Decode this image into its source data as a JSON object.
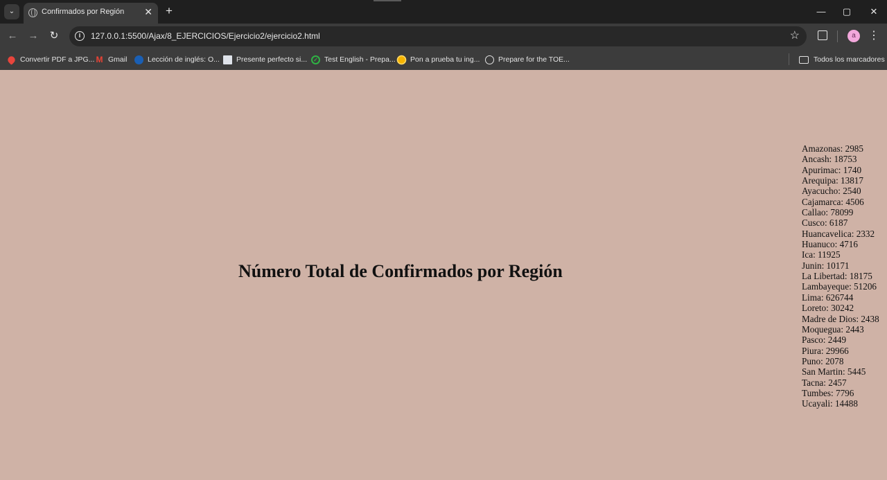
{
  "browser": {
    "tab_title": "Confirmados por Región",
    "tab_close": "✕",
    "new_tab": "+",
    "url": "127.0.0.1:5500/Ajax/8_EJERCICIOS/Ejercicio2/ejercicio2.html",
    "window_controls": {
      "minimize": "—",
      "maximize": "▢",
      "close": "✕"
    }
  },
  "bookmarks": [
    {
      "label": "Convertir PDF a JPG...",
      "icon": "pdf-heart-icon",
      "color": "#e8453c"
    },
    {
      "label": "Gmail",
      "icon": "gmail-icon",
      "color": "#ea4335"
    },
    {
      "label": "Lección de inglés: O...",
      "icon": "lesson-icon",
      "color": "#1a5fb4"
    },
    {
      "label": "Presente perfecto si...",
      "icon": "document-icon",
      "color": "#dfe3ea"
    },
    {
      "label": "Test English - Prepa...",
      "icon": "check-icon",
      "color": "#2fb344"
    },
    {
      "label": "Pon a prueba tu ing...",
      "icon": "sun-icon",
      "color": "#f6b400"
    },
    {
      "label": "Prepare for the TOE...",
      "icon": "ets-icon",
      "color": "#e3e3e3"
    }
  ],
  "bookmarks_folder": "Todos los marcadores",
  "avatar_letter": "a",
  "page": {
    "heading": "Número Total de Confirmados por Región",
    "regions": [
      "Amazonas: 2985",
      "Ancash: 18753",
      "Apurimac: 1740",
      "Arequipa: 13817",
      "Ayacucho: 2540",
      "Cajamarca: 4506",
      "Callao: 78099",
      "Cusco: 6187",
      "Huancavelica: 2332",
      "Huanuco: 4716",
      "Ica: 11925",
      "Junin: 10171",
      "La Libertad: 18175",
      "Lambayeque: 51206",
      "Lima: 626744",
      "Loreto: 30242",
      "Madre de Dios: 2438",
      "Moquegua: 2443",
      "Pasco: 2449",
      "Piura: 29966",
      "Puno: 2078",
      "San Martin: 5445",
      "Tacna: 2457",
      "Tumbes: 7796",
      "Ucayali: 14488"
    ],
    "background": "#cfb2a6"
  }
}
